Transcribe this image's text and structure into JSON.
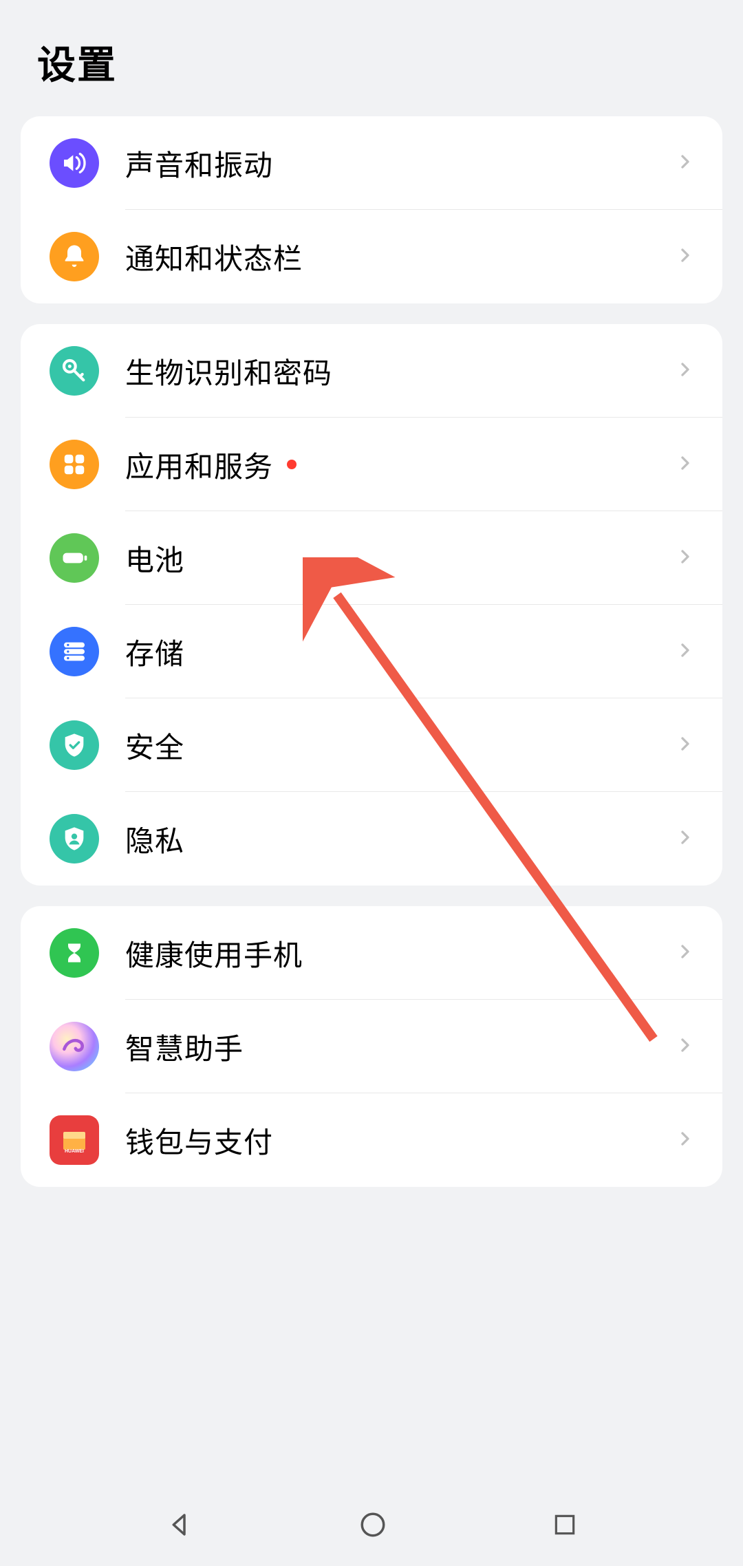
{
  "header": {
    "title": "设置"
  },
  "groups": [
    {
      "items": [
        {
          "key": "sound",
          "label": "声音和振动",
          "icon": "volume",
          "bg": "bg-purple",
          "dot": false
        },
        {
          "key": "notif",
          "label": "通知和状态栏",
          "icon": "bell",
          "bg": "bg-orange",
          "dot": false
        }
      ]
    },
    {
      "items": [
        {
          "key": "biometric",
          "label": "生物识别和密码",
          "icon": "key",
          "bg": "bg-teal",
          "dot": false
        },
        {
          "key": "apps",
          "label": "应用和服务",
          "icon": "grid",
          "bg": "bg-orange",
          "dot": true
        },
        {
          "key": "battery",
          "label": "电池",
          "icon": "battery",
          "bg": "bg-green",
          "dot": false
        },
        {
          "key": "storage",
          "label": "存储",
          "icon": "storage",
          "bg": "bg-blue",
          "dot": false
        },
        {
          "key": "security",
          "label": "安全",
          "icon": "shield-check",
          "bg": "bg-teal",
          "dot": false
        },
        {
          "key": "privacy",
          "label": "隐私",
          "icon": "shield-user",
          "bg": "bg-teal",
          "dot": false
        }
      ]
    },
    {
      "items": [
        {
          "key": "health",
          "label": "健康使用手机",
          "icon": "hourglass",
          "bg": "bg-lgreen",
          "dot": false
        },
        {
          "key": "assist",
          "label": "智慧助手",
          "icon": "swirl",
          "bg": "bg-gradient",
          "dot": false
        },
        {
          "key": "wallet",
          "label": "钱包与支付",
          "icon": "wallet",
          "bg": "bg-red",
          "dot": false
        }
      ]
    }
  ]
}
